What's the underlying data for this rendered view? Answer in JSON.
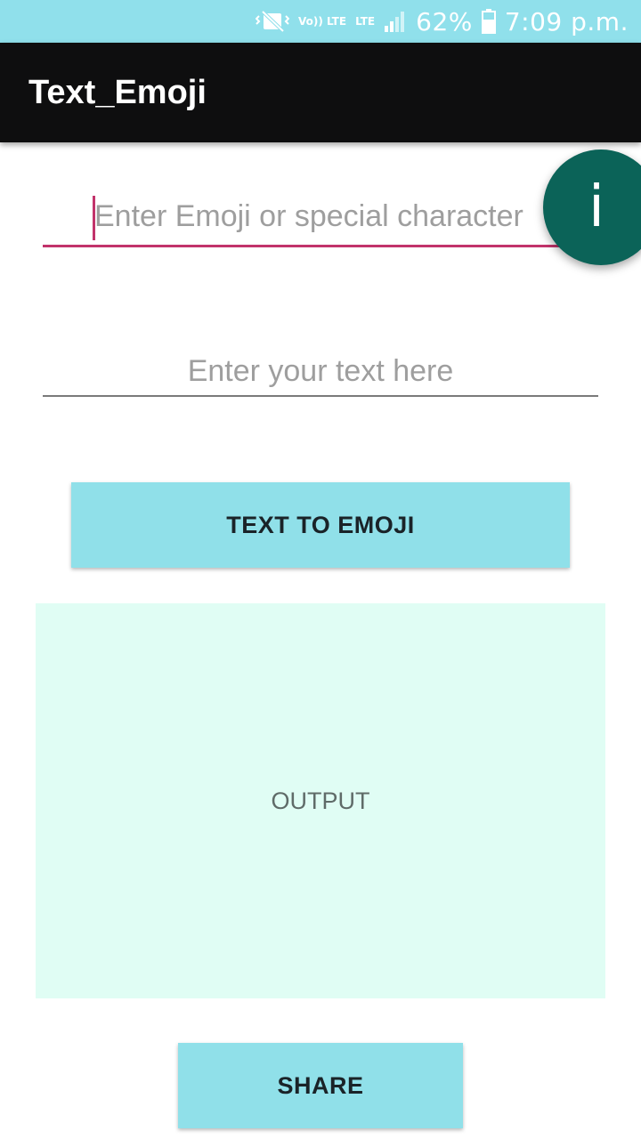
{
  "status_bar": {
    "volte_label": "Vo)) LTE",
    "lte_label": "LTE",
    "battery_percent": "62%",
    "time": "7:09 p.m."
  },
  "app_bar": {
    "title": "Text_Emoji"
  },
  "form": {
    "emoji_placeholder": "Enter Emoji or special character",
    "text_placeholder": "Enter your text here",
    "convert_label": "TEXT TO EMOJI",
    "share_label": "SHARE"
  },
  "output": {
    "text": "OUTPUT"
  },
  "fab": {
    "glyph": "i",
    "icon": "info-icon"
  },
  "colors": {
    "status_bar": "#90e0eb",
    "app_bar": "#0e0e0f",
    "accent": "#c2336b",
    "fab": "#0b6358",
    "button": "#90e0e9",
    "output_bg": "#e0fdf4"
  }
}
